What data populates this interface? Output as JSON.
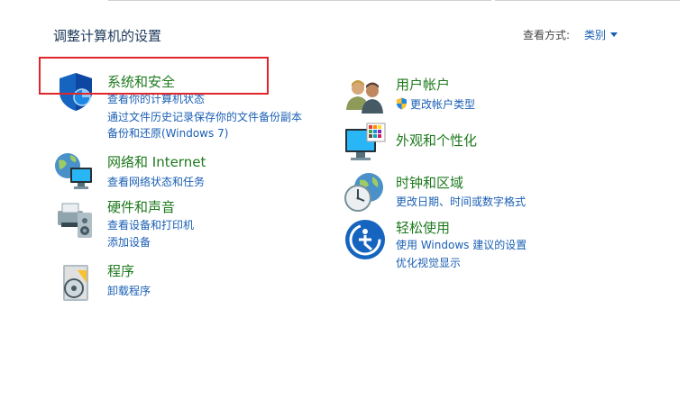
{
  "header": {
    "title": "调整计算机的设置",
    "view_by_label": "查看方式:",
    "view_by_value": "类别"
  },
  "categories": {
    "system_security": {
      "title": "系统和安全",
      "links": [
        "查看你的计算机状态",
        "通过文件历史记录保存你的文件备份副本",
        "备份和还原(Windows 7)"
      ]
    },
    "network": {
      "title": "网络和 Internet",
      "links": [
        "查看网络状态和任务"
      ]
    },
    "hardware_sound": {
      "title": "硬件和声音",
      "links": [
        "查看设备和打印机",
        "添加设备"
      ]
    },
    "programs": {
      "title": "程序",
      "links": [
        "卸载程序"
      ]
    },
    "user_accounts": {
      "title": "用户帐户",
      "links": [
        "更改帐户类型"
      ]
    },
    "appearance": {
      "title": "外观和个性化",
      "links": []
    },
    "clock_region": {
      "title": "时钟和区域",
      "links": [
        "更改日期、时间或数字格式"
      ]
    },
    "ease_of_access": {
      "title": "轻松使用",
      "links": [
        "使用 Windows 建议的设置",
        "优化视觉显示"
      ]
    }
  },
  "colors": {
    "category_title": "#1e7a1e",
    "link": "#1a5fb4",
    "highlight": "#e0262b",
    "page_title": "#1e395b"
  },
  "icons": {
    "system_security": "shield-icon",
    "network": "network-globe-icon",
    "hardware_sound": "printer-speaker-icon",
    "programs": "programs-disc-icon",
    "user_accounts": "users-icon",
    "appearance": "monitor-palette-icon",
    "clock_region": "clock-globe-icon",
    "ease_of_access": "ease-of-access-icon"
  }
}
